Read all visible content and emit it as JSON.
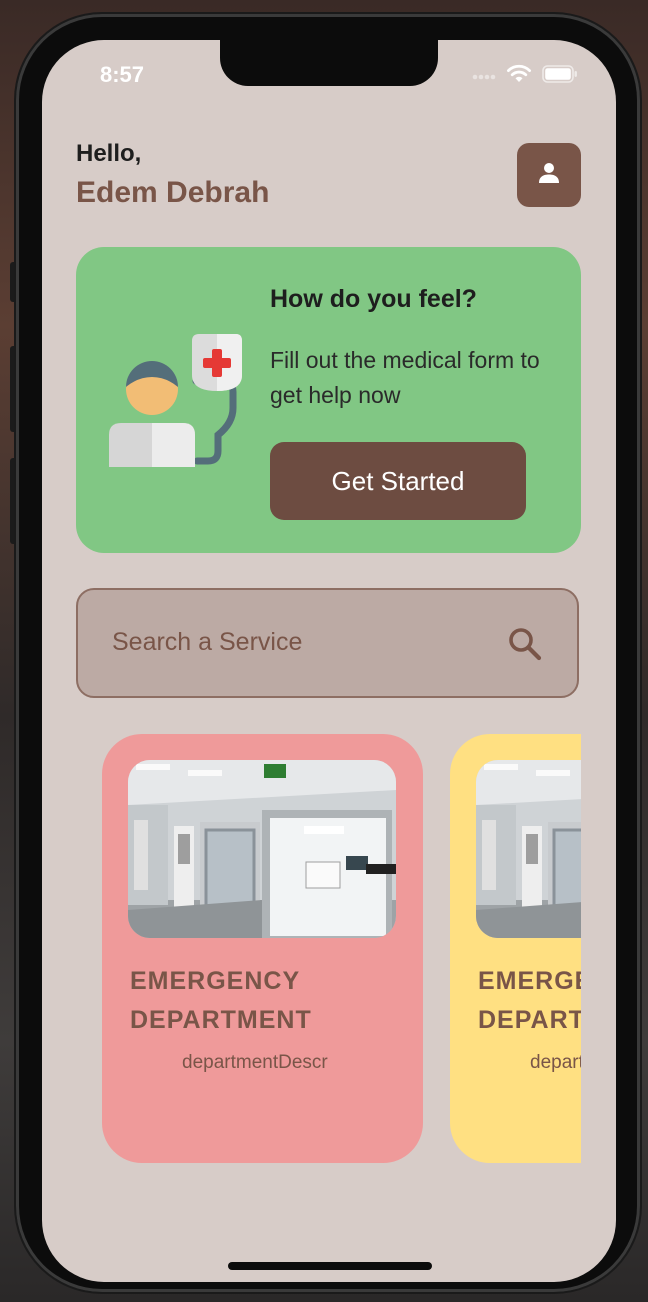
{
  "status_bar": {
    "time": "8:57"
  },
  "header": {
    "greeting": "Hello,",
    "user_name": "Edem Debrah"
  },
  "feel_card": {
    "title": "How do you feel?",
    "text": "Fill out the medical form to get help now",
    "button_label": "Get Started"
  },
  "search": {
    "placeholder": "Search a Service"
  },
  "services": [
    {
      "title": "EMERGENCY DEPARTMENT",
      "description": "departmentDescr",
      "color": "#ef9a9a"
    },
    {
      "title": "EMERGENCY DEPARTMENT",
      "description": "departmentDescr",
      "color": "#ffe082"
    }
  ],
  "colors": {
    "background": "#d7ccc8",
    "accent_brown": "#795548",
    "button_brown": "#6d4c41",
    "feel_card_green": "#81c784",
    "search_fill": "#bcaaa4"
  },
  "icons": [
    "wifi-icon",
    "battery-icon",
    "person-icon",
    "search-icon",
    "doctor-iv-illustration"
  ]
}
